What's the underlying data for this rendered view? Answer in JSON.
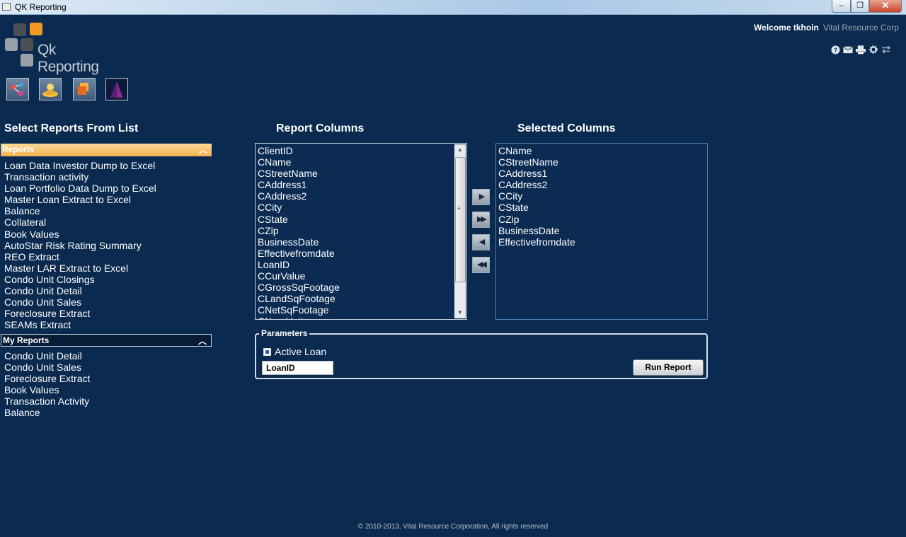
{
  "window": {
    "title": "QK Reporting",
    "min": "–",
    "max": "❐",
    "close": "✕"
  },
  "header": {
    "logo_text": "Qk Reporting",
    "welcome": "Welcome tkhoin",
    "company": "Vital Resource Corp",
    "icons": [
      "help-icon",
      "mail-icon",
      "print-icon",
      "settings-icon",
      "swap-icon"
    ]
  },
  "toolbar": {
    "buttons": [
      "network-icon",
      "user-icon",
      "layers-icon",
      "pyramid-icon"
    ]
  },
  "left": {
    "heading": "Select Reports From List",
    "reports_header": "Reports",
    "reports": [
      "Loan Data Investor Dump to Excel",
      "Transaction activity",
      "Loan Portfolio Data Dump to Excel",
      "Master Loan Extract to Excel",
      "Balance",
      "Collateral",
      "Book Values",
      "AutoStar Risk Rating Summary",
      "REO Extract",
      "Master LAR Extract to Excel",
      "Condo Unit Closings",
      "Condo Unit Detail",
      "Condo Unit Sales",
      "Foreclosure Extract",
      "SEAMs Extract"
    ],
    "my_reports_header": "My Reports",
    "my_reports": [
      "Condo Unit Detail",
      "Condo Unit Sales",
      "Foreclosure Extract",
      "Book Values",
      "Transaction Activity",
      "Balance"
    ]
  },
  "report_columns": {
    "heading": "Report Columns",
    "items": [
      "ClientID",
      "CName",
      "CStreetName",
      "CAddress1",
      "CAddress2",
      "CCity",
      "CState",
      "CZip",
      "BusinessDate",
      "Effectivefromdate",
      "LoanID",
      "CCurValue",
      "CGrossSqFootage",
      "CLandSqFootage",
      "CNetSqFootage",
      "CNumUnits"
    ]
  },
  "selected_columns": {
    "heading": "Selected Columns",
    "items": [
      "CName",
      "CStreetName",
      "CAddress1",
      "CAddress2",
      "CCity",
      "CState",
      "CZip",
      "BusinessDate",
      "Effectivefromdate"
    ]
  },
  "move_buttons": {
    "add": "▶",
    "add_all": "▶▶",
    "remove": "◀",
    "remove_all": "◀◀"
  },
  "parameters": {
    "legend": "Parameters",
    "active_loan_label": "Active Loan",
    "active_loan_checked": true,
    "loan_field_value": "LoanID",
    "run_button": "Run Report"
  },
  "footer": "© 2010-2013, Vital Resource Corporation, All rights reserved",
  "colors": {
    "background": "#0a2a4f",
    "reports_header": "#f3b24f",
    "logo_orange": "#f39a26",
    "logo_gray": "#8a9099"
  }
}
